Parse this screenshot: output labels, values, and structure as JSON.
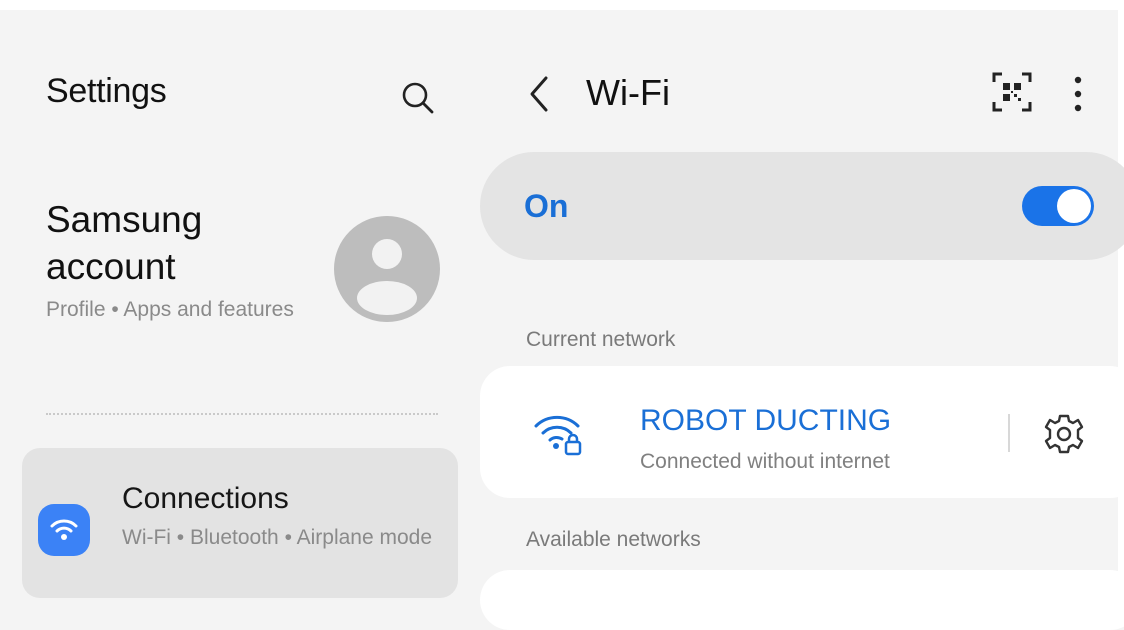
{
  "left_pane": {
    "title": "Settings",
    "search_icon": "search-icon",
    "account": {
      "title": "Samsung account",
      "subtitle": "Profile • Apps and features",
      "avatar_icon": "person-icon"
    },
    "connections": {
      "title": "Connections",
      "subtitle": "Wi-Fi • Bluetooth • Airplane mode",
      "icon": "wifi-icon",
      "icon_color": "#3b82f6"
    }
  },
  "right_pane": {
    "title": "Wi-Fi",
    "back_icon": "chevron-left-icon",
    "qr_icon": "qr-scan-icon",
    "more_icon": "more-vert-icon",
    "master_switch": {
      "label": "On",
      "state": "on",
      "accent_color": "#1a73e8"
    },
    "current_network_header": "Current network",
    "current_network": {
      "name": "ROBOT DUCTING",
      "status": "Connected without internet",
      "icon": "wifi-lock-icon",
      "settings_icon": "gear-icon"
    },
    "available_networks_header": "Available networks"
  }
}
